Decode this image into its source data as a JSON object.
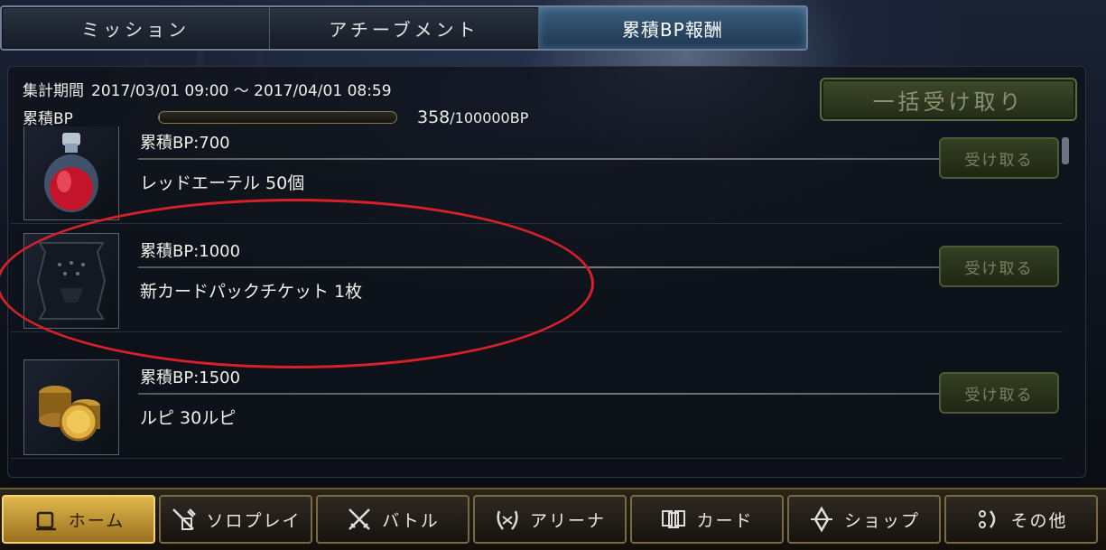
{
  "tabs": [
    {
      "label": "ミッション",
      "active": false
    },
    {
      "label": "アチーブメント",
      "active": false
    },
    {
      "label": "累積BP報酬",
      "active": true
    }
  ],
  "summary": {
    "period_label": "集計期間",
    "period_value": "2017/03/01 09:00 ～ 2017/04/01 08:59",
    "bp_label": "累積BP",
    "bp_current": "358",
    "bp_total": "/100000BP",
    "bp_fraction": 0.00358
  },
  "bulk_button": "一括受け取り",
  "rewards": [
    {
      "requirement": "累積BP:700",
      "item": "レッドエーテル 50個",
      "claim": "受け取る",
      "icon": "red-ether-potion-icon"
    },
    {
      "requirement": "累積BP:1000",
      "item": "新カードパックチケット 1枚",
      "claim": "受け取る",
      "icon": "card-pack-ticket-icon"
    },
    {
      "requirement": "累積BP:1500",
      "item": "ルピ 30ルピ",
      "claim": "受け取る",
      "icon": "rupie-coins-icon"
    }
  ],
  "bottom_nav": [
    {
      "label": "ホーム",
      "icon": "home-icon",
      "active": true
    },
    {
      "label": "ソロプレイ",
      "icon": "solo-play-icon",
      "active": false
    },
    {
      "label": "バトル",
      "icon": "crossed-swords-icon",
      "active": false
    },
    {
      "label": "アリーナ",
      "icon": "arena-laurel-icon",
      "active": false
    },
    {
      "label": "カード",
      "icon": "cards-icon",
      "active": false
    },
    {
      "label": "ショップ",
      "icon": "shop-crystal-icon",
      "active": false
    },
    {
      "label": "その他",
      "icon": "other-icon",
      "active": false
    }
  ],
  "colors": {
    "active_tab": "#2e4e6e",
    "highlight_ellipse": "#d8202a",
    "active_nav": "#d8b04a"
  }
}
